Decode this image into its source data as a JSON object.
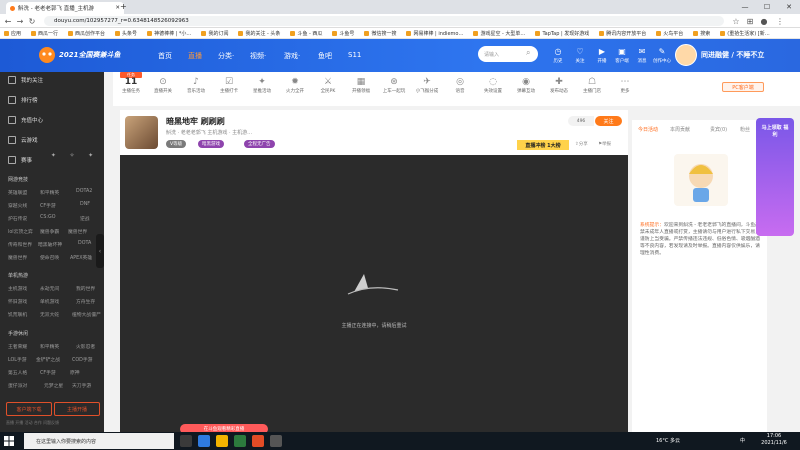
{
  "browser": {
    "tabs": [
      {
        "title": "斛洗 - 老老老郭飞 直播_主机游"
      }
    ],
    "new_tab_label": "+",
    "url": "douyu.com/102957277_r=0.6348148526092963",
    "nav": {
      "back": "←",
      "forward": "→",
      "reload": "↻",
      "home": "⌂"
    },
    "window": {
      "min": "—",
      "max": "☐",
      "close": "✕"
    },
    "bookmarks": [
      "应用",
      "西瓜一行",
      "西瓜创作平台",
      "头条号",
      "神德棒棒 | *小…",
      "我的订阅",
      "我的关注 - 头条",
      "斗鱼 - 西瓜",
      "斗鱼号",
      "微信搜一搜",
      "网易棒棒 | indiemo…",
      "游戏星空 - 大型单…",
      "TapTap | 发现好游戏",
      "腾讯内容开放平台",
      "火鸟平台",
      "搜索",
      "(重拾生活家) [新…"
    ]
  },
  "site": {
    "logo_text": "2021全国赛兼斗鱼",
    "nav": [
      "首页",
      "直播",
      "分类·",
      "视频·",
      "游戏·",
      "鱼吧",
      "S11"
    ],
    "active_nav_index": 1,
    "search_placeholder": "请输入",
    "header_icons": [
      {
        "label": "历史",
        "glyph": "◷",
        "icon": "history-icon"
      },
      {
        "label": "关注",
        "glyph": "♡",
        "icon": "follow-icon"
      },
      {
        "label": "开播",
        "glyph": "▶",
        "icon": "broadcast-icon"
      },
      {
        "label": "客户端",
        "glyph": "▣",
        "icon": "client-icon"
      },
      {
        "label": "消息",
        "glyph": "✉",
        "icon": "message-icon"
      },
      {
        "label": "创作中心",
        "glyph": "✎",
        "icon": "creator-icon"
      }
    ],
    "user_banner": "同进融健 / 不睡不立"
  },
  "sidebar": {
    "items": [
      {
        "label": "我的关注",
        "name": "sidebar-item-following"
      },
      {
        "label": "排行榜",
        "name": "sidebar-item-ranking"
      },
      {
        "label": "充值中心",
        "name": "sidebar-item-recharge"
      },
      {
        "label": "云游戏",
        "name": "sidebar-item-cloud-game"
      },
      {
        "label": "赛事",
        "name": "sidebar-item-esports"
      }
    ],
    "sections": [
      {
        "title": "网游竞技",
        "subs": [
          "英雄联盟",
          "和平精英",
          "DOTA2",
          "穿越火线",
          "CF手游",
          "DNF",
          "炉石传说",
          "CS:GO",
          "逆战",
          "lol云顶之弈",
          "魔兽争霸",
          "魔兽世界",
          "传奇和世界",
          "暗黑破坏神",
          "DOTA",
          "魔兽世界",
          "使命召唤",
          "APEX英雄"
        ]
      },
      {
        "title": "单机热游",
        "subs": [
          "主机游戏",
          "永劫无间",
          "我的世界",
          "怀旧游戏",
          "单机游戏",
          "方舟生存",
          "饥荒联机",
          "无双大蛇",
          "植物大战僵尸"
        ]
      },
      {
        "title": "手游休闲",
        "subs": [
          "王者荣耀",
          "和平精英",
          "火影忍者",
          "LOL手游",
          "金铲铲之战",
          "COD手游",
          "第五人格",
          "CF手游",
          "原神",
          "蛋仔派对",
          "元梦之星",
          "天刀手游"
        ]
      }
    ],
    "bottom_buttons": [
      "客户端下载",
      "主播开播"
    ],
    "footer": "直播 开播 活动 合作  问题反馈"
  },
  "categories": [
    {
      "label": "主播任务",
      "glyph": "11"
    },
    {
      "label": "直播开关",
      "glyph": "⊙"
    },
    {
      "label": "音乐活动",
      "glyph": "♪"
    },
    {
      "label": "主播打卡",
      "glyph": "☑"
    },
    {
      "label": "星推活动",
      "glyph": "✦"
    },
    {
      "label": "火力全开",
      "glyph": "✹"
    },
    {
      "label": "全民PK",
      "glyph": "⚔"
    },
    {
      "label": "开播领福",
      "glyph": "▦"
    },
    {
      "label": "上车一起玩",
      "glyph": "⊛"
    },
    {
      "label": "小飞猴分成",
      "glyph": "✈"
    },
    {
      "label": "语音",
      "glyph": "◎"
    },
    {
      "label": "失效设置",
      "glyph": "◌"
    },
    {
      "label": "弹幕互动",
      "glyph": "◉"
    },
    {
      "label": "发布动态",
      "glyph": "✚"
    },
    {
      "label": "主播门店",
      "glyph": "☖"
    },
    {
      "label": "更多",
      "glyph": "⋯"
    }
  ],
  "pc_button": "PC客户端",
  "room": {
    "title": "暗黑地牢 刷刷刷",
    "streamer": "斛洗 · 老老老郭飞",
    "subline": "斛洗 · 老老老郭飞  主机游戏 · 主机游…",
    "level": "V等级",
    "tags": [
      "暗黑游戏",
      "全程无广告"
    ],
    "follow_label": "关注",
    "follow_count": "496",
    "champion_badge": "直播冲榜 1大榜",
    "side_icons": [
      "分享",
      "举报"
    ]
  },
  "video": {
    "loading_text": "主播正在连接中，请稍后重试",
    "promo": "在斗鱼观看精彩直播"
  },
  "right_panel": {
    "tabs": [
      "今日活动",
      "本周贡献",
      "贵宾(0)",
      "粉丝"
    ],
    "active_tab": 0,
    "notice_label": "系统提示：",
    "notice_text": "欢迎来到斛洗 - 老老老郭飞的直播间，斗鱼严禁未成年人直播或打赏，主播请勿与用户进行私下交易，谨防上当受骗。严禁传播违法违规、低俗色情、吸烟酗酒等不良内容，若发现请及时举报。直播内容仅供娱乐，请理性消费。",
    "ad_text": "马上领取 福利"
  },
  "taskbar": {
    "search_placeholder": "在这里输入你要搜索的内容",
    "weather": "16°C 多云",
    "lang": "中",
    "time": "17:06",
    "date": "2021/11/6"
  }
}
